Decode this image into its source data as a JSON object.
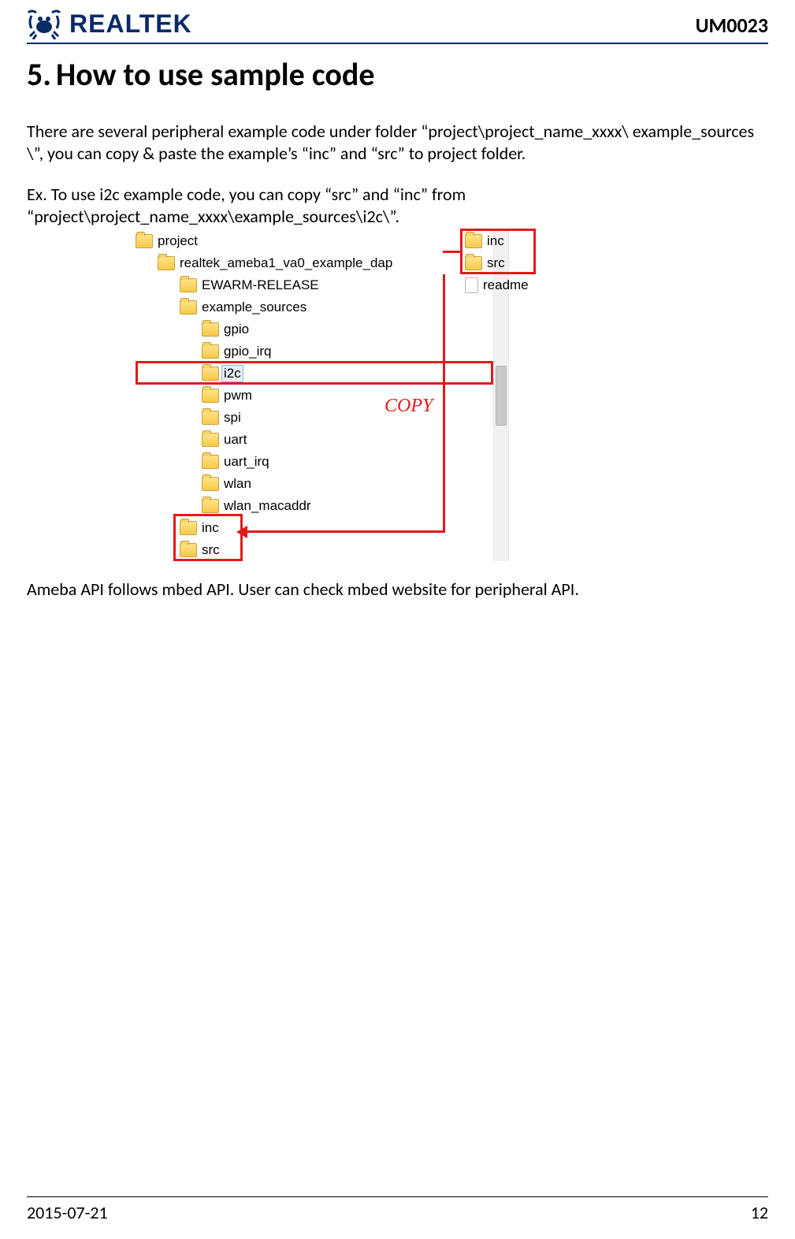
{
  "header": {
    "brand": "REALTEK",
    "doc_id": "UM0023"
  },
  "section": {
    "number": "5.",
    "title": "How to use sample code"
  },
  "body": {
    "p1": "There are several peripheral example code under folder “project\\project_name_xxxx\\ example_sources \\”, you can copy & paste the example’s “inc” and “src” to project folder.",
    "p2": "Ex. To use i2c example code, you can copy “src” and “inc” from “project\\project_name_xxxx\\example_sources\\i2c\\”.",
    "p3": "Ameba API follows mbed API. User can check mbed website for peripheral API."
  },
  "tree": {
    "n0": "project",
    "n1": "realtek_ameba1_va0_example_dap",
    "n2": "EWARM-RELEASE",
    "n3": "example_sources",
    "n4": "gpio",
    "n5": "gpio_irq",
    "n6": "i2c",
    "n7": "pwm",
    "n8": "spi",
    "n9": "uart",
    "n10": "uart_irq",
    "n11": "wlan",
    "n12": "wlan_macaddr",
    "dest_inc": "inc",
    "dest_src": "src"
  },
  "copy_col": {
    "inc": "inc",
    "src": "src",
    "readme": "readme",
    "label": "COPY"
  },
  "footer": {
    "date": "2015-07-21",
    "page": "12"
  }
}
